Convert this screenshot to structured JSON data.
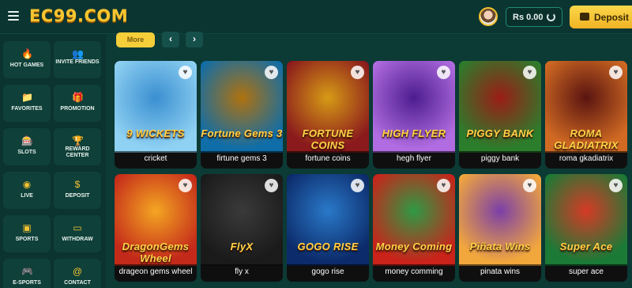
{
  "header": {
    "logo": "EC99.COM",
    "balance": "Rs 0.00",
    "deposit_label": "Deposit"
  },
  "sidebar": {
    "items": [
      {
        "label": "HOT GAMES",
        "icon": "fire-icon"
      },
      {
        "label": "INVITE FRIENDS",
        "icon": "users-icon"
      },
      {
        "label": "FAVORITES",
        "icon": "folder-icon"
      },
      {
        "label": "PROMOTION",
        "icon": "gift-icon"
      },
      {
        "label": "SLOTS",
        "icon": "slot-machine-icon"
      },
      {
        "label": "REWARD CENTER",
        "icon": "trophy-icon"
      },
      {
        "label": "LIVE",
        "icon": "live-icon"
      },
      {
        "label": "DEPOSIT",
        "icon": "dollar-icon"
      },
      {
        "label": "SPORTS",
        "icon": "sports-icon"
      },
      {
        "label": "WITHDRAW",
        "icon": "laptop-icon"
      },
      {
        "label": "E-SPORTS",
        "icon": "gamepad-icon"
      },
      {
        "label": "CONTACT",
        "icon": "at-icon"
      }
    ]
  },
  "controls": {
    "more_label": "More",
    "prev": "‹",
    "next": "›"
  },
  "games": [
    {
      "title": "cricket",
      "art": "9 WICKETS",
      "colors": [
        "#8fd1f3",
        "#3a8fd0"
      ]
    },
    {
      "title": "firtune gems 3",
      "art": "Fortune Gems 3",
      "colors": [
        "#0f6da8",
        "#b0720f"
      ]
    },
    {
      "title": "fortune coins",
      "art": "FORTUNE COINS",
      "colors": [
        "#8a1a1c",
        "#d79b16"
      ]
    },
    {
      "title": "hegh flyer",
      "art": "HIGH FLYER",
      "colors": [
        "#b06ce0",
        "#4c1d8f"
      ]
    },
    {
      "title": "piggy bank",
      "art": "PIGGY BANK",
      "colors": [
        "#2b7d2c",
        "#9b1d15"
      ]
    },
    {
      "title": "roma gkadiatrix",
      "art": "ROMA GLADIATRIX",
      "colors": [
        "#d06a23",
        "#5a1410"
      ]
    },
    {
      "title": "drageon gems wheel",
      "art": "DragonGems Wheel",
      "colors": [
        "#c42a1a",
        "#f4a622"
      ]
    },
    {
      "title": "fly x",
      "art": "FlyX",
      "colors": [
        "#1a1a1a",
        "#3a3a3a"
      ]
    },
    {
      "title": "gogo rise",
      "art": "GOGO RISE",
      "colors": [
        "#0c2b6a",
        "#2a79c9"
      ]
    },
    {
      "title": "money comming",
      "art": "Money Coming",
      "colors": [
        "#c9231a",
        "#2e9a44"
      ]
    },
    {
      "title": "pinata wins",
      "art": "Piñata Wins",
      "colors": [
        "#f2a73c",
        "#7b3fa8"
      ]
    },
    {
      "title": "super ace",
      "art": "Super Ace",
      "colors": [
        "#1a7a36",
        "#d63a26"
      ]
    }
  ],
  "colors": {
    "accent": "#f6ce3a",
    "brand": "#f6c531",
    "background": "#0c3a35"
  }
}
